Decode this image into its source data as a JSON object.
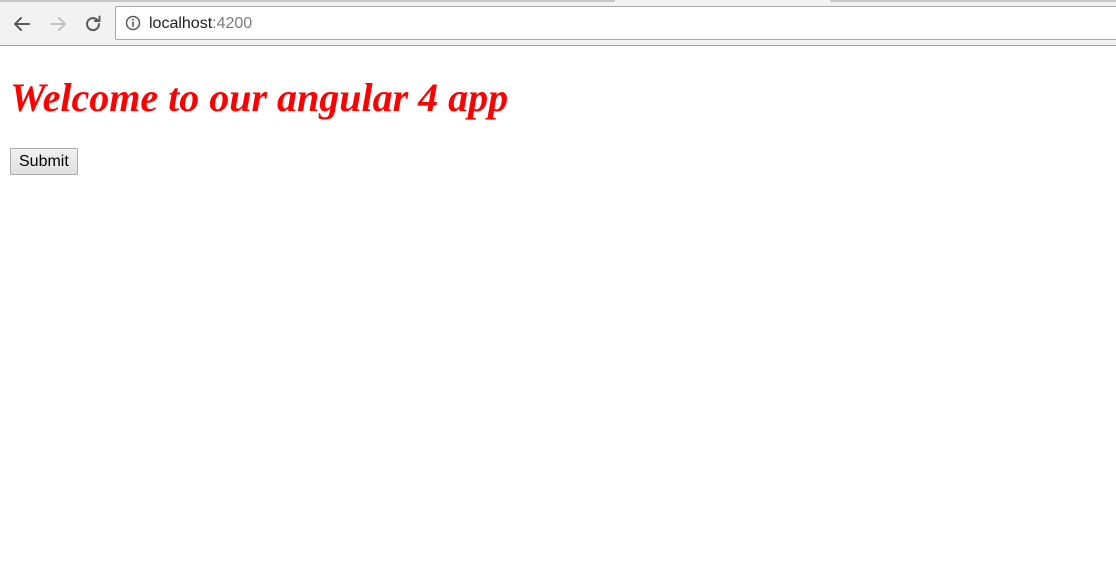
{
  "browser": {
    "url_host": "localhost",
    "url_port": ":4200",
    "icons": {
      "back": "arrow-left-icon",
      "forward": "arrow-right-icon",
      "reload": "reload-icon",
      "site_info": "info-icon"
    }
  },
  "page": {
    "heading": "Welcome to our angular 4 app",
    "heading_color": "#ff0000",
    "submit_label": "Submit"
  }
}
